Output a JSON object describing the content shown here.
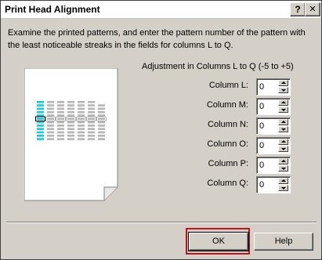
{
  "window": {
    "title": "Print Head Alignment",
    "title_buttons": {
      "help": "?",
      "close": "✕"
    }
  },
  "instructions": "Examine the printed patterns, and enter the pattern number of the pattern with the least noticeable streaks in the fields for columns L to Q.",
  "adjustment": {
    "header": "Adjustment in Columns L to Q (-5 to +5)",
    "rows": [
      {
        "label": "Column L:",
        "value": "0"
      },
      {
        "label": "Column M:",
        "value": "0"
      },
      {
        "label": "Column N:",
        "value": "0"
      },
      {
        "label": "Column O:",
        "value": "0"
      },
      {
        "label": "Column P:",
        "value": "0"
      },
      {
        "label": "Column Q:",
        "value": "0"
      }
    ]
  },
  "pattern_colors": {
    "cyan": "#16c8e0",
    "gray": "#b4b4b4",
    "highlight": "#c0141c"
  },
  "buttons": {
    "ok": "OK",
    "help": "Help"
  }
}
